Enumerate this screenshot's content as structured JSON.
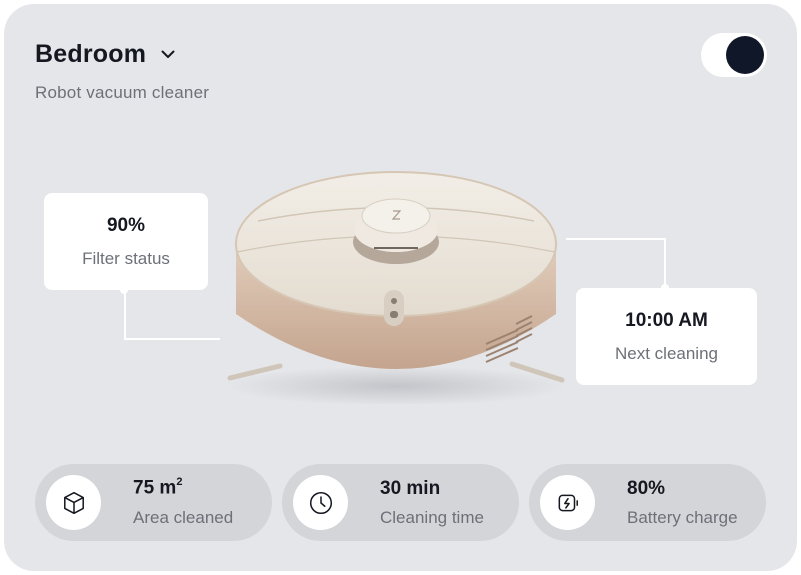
{
  "header": {
    "title": "Bedroom",
    "subtitle": "Robot vacuum cleaner"
  },
  "power_toggle": {
    "state": "on"
  },
  "callouts": {
    "filter": {
      "value": "90%",
      "label": "Filter status"
    },
    "next_cleaning": {
      "value": "10:00 AM",
      "label": "Next cleaning"
    }
  },
  "stats": {
    "area": {
      "value": "75 m",
      "unit_sup": "2",
      "label": "Area cleaned",
      "icon": "cube-icon"
    },
    "time": {
      "value": "30 min",
      "label": "Cleaning time",
      "icon": "clock-icon"
    },
    "battery": {
      "value": "80%",
      "label": "Battery charge",
      "icon": "battery-charging-icon"
    }
  },
  "colors": {
    "card_background": "#e5e6e9",
    "pill_background": "#d4d5d8",
    "toggle_knob": "#0f1729",
    "robot_body": "#ede7dd",
    "robot_base": "#d1b5a1"
  }
}
